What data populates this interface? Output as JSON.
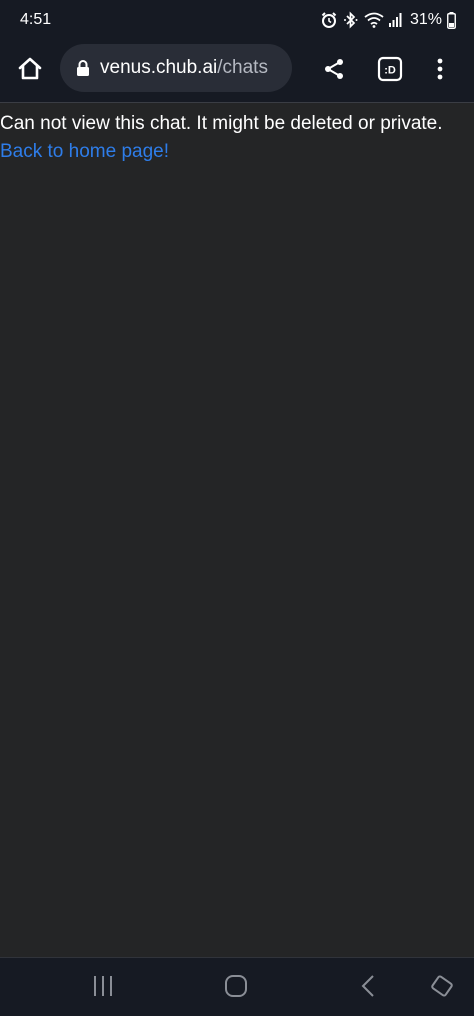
{
  "status_bar": {
    "time": "4:51",
    "battery_percent": "31%",
    "icons": [
      "alarm-icon",
      "bluetooth-icon",
      "wifi-icon",
      "signal-icon",
      "battery-icon"
    ]
  },
  "browser": {
    "url_domain": "venus.chub.ai",
    "url_path": "/chats",
    "extension_label": ":D",
    "icons": [
      "home-icon",
      "lock-icon",
      "share-icon",
      "extension-icon",
      "more-vert-icon"
    ]
  },
  "page": {
    "message": "Can not view this chat. It might be deleted or private.",
    "link_text": "Back to home page!"
  },
  "nav_bar": {
    "icons": [
      "recents-icon",
      "home-circle-icon",
      "back-icon",
      "rotate-icon"
    ]
  },
  "colors": {
    "background": "#242526",
    "chrome": "#161a23",
    "url_bar": "#292d37",
    "link": "#2e7de9",
    "text": "#ffffff"
  }
}
